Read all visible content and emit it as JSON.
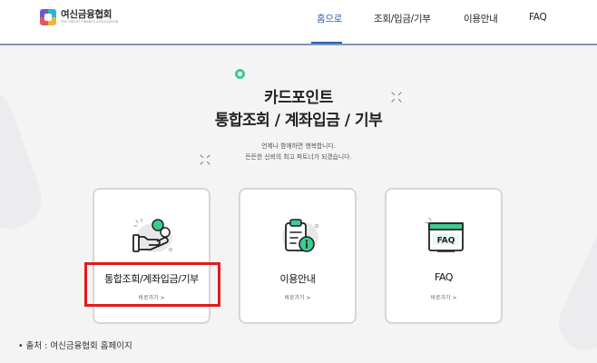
{
  "header": {
    "logo_name": "여신금융협회",
    "logo_sub": "THE CREDIT FINANCE ASSOCIATION",
    "nav": [
      {
        "label": "홈으로",
        "active": true
      },
      {
        "label": "조회/입금/기부",
        "active": false
      },
      {
        "label": "이용안내",
        "active": false
      },
      {
        "label": "FAQ",
        "active": false
      }
    ]
  },
  "hero": {
    "title_line1": "카드포인트",
    "title_line2": "통합조회 / 계좌입금 / 기부",
    "subtitle_line1": "언제나 함께하면 행복합니다.",
    "subtitle_line2": "든든한 신뢰의 최고 파트너가 되겠습니다."
  },
  "cards": [
    {
      "title": "통합조회/계좌입금/기부",
      "link": "바로가기 >",
      "icon": "hand-coin-icon"
    },
    {
      "title": "이용안내",
      "link": "바로가기 >",
      "icon": "clipboard-info-icon"
    },
    {
      "title": "FAQ",
      "link": "바로가기 >",
      "icon": "faq-window-icon"
    }
  ],
  "source_note": "• 출처 : 여신금융협회 홈페이지",
  "colors": {
    "accent": "#2d5fa8",
    "green": "#3dcc8f",
    "highlight": "#e11b1b",
    "background": "#f4f4f5"
  }
}
